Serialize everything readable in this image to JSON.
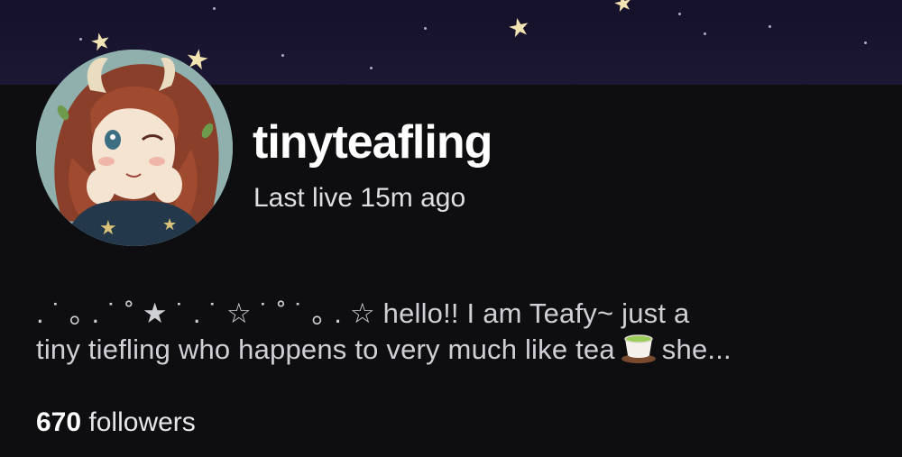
{
  "channel": {
    "name": "tinyteafling",
    "last_live": "Last live 15m ago"
  },
  "bio": {
    "line1": ". ˙ ｡ . ˙ ˚  ★ ˙ . ˙ ☆ ˙ ˚   ˙ ｡ . ☆ hello!! I am Teafy~ just a",
    "line2_before_icon": "tiny tiefling who happens to very much like tea",
    "line2_after_icon": "she...",
    "icon": "green-tea-cup-icon"
  },
  "followers": {
    "count": "670",
    "label": "followers"
  },
  "colors": {
    "background": "#0e0e10",
    "banner": "#1a1630",
    "star": "#f2e3b3",
    "text_primary": "#ffffff",
    "text_secondary": "#cfcfd6"
  }
}
